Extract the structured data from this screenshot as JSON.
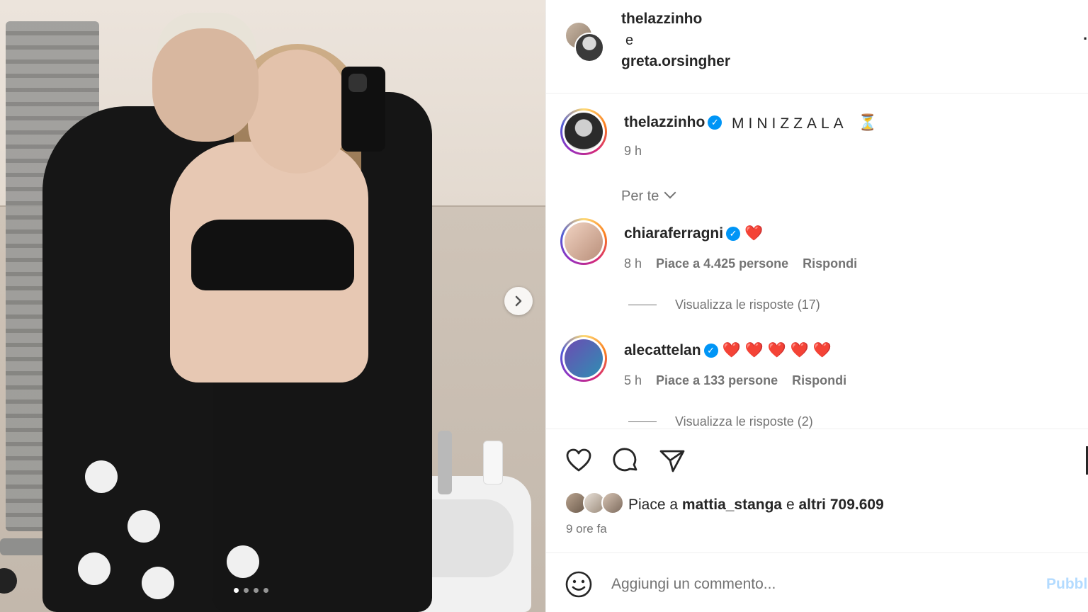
{
  "header": {
    "user1": "thelazzinho",
    "conjunction": "e",
    "user2": "greta.orsingher",
    "more_icon": "more-options-icon"
  },
  "photo": {
    "next_icon": "chevron-right-icon",
    "carousel_pages": 4,
    "carousel_active": 0
  },
  "caption": {
    "username": "thelazzinho",
    "text": "MINIZZALA",
    "emoji": "⏳",
    "time": "9 h"
  },
  "filter": {
    "label": "Per te"
  },
  "comments": [
    {
      "username": "chiaraferragni",
      "verified": true,
      "text": "❤️",
      "time": "8 h",
      "likes": "Piace a 4.425 persone",
      "reply": "Rispondi",
      "replies": "Visualizza le risposte (17)"
    },
    {
      "username": "alecattelan",
      "verified": true,
      "text": "❤️ ❤️ ❤️ ❤️ ❤️",
      "time": "5 h",
      "likes": "Piace a 133 persone",
      "reply": "Rispondi",
      "replies": "Visualizza le risposte (2)"
    }
  ],
  "actions": {
    "like_icon": "heart-icon",
    "comment_icon": "comment-icon",
    "share_icon": "share-icon",
    "save_icon": "bookmark-icon",
    "likes_prefix": "Piace a",
    "likes_user": "mattia_stanga",
    "likes_middle": "e",
    "likes_others": "altri 709.609",
    "post_time": "9 ore fa"
  },
  "comment_box": {
    "placeholder": "Aggiungi un commento...",
    "publish": "Pubblica"
  },
  "colors": {
    "verified": "#0095f6",
    "heart": "#e0182d",
    "publish_disabled": "#b3dbff",
    "secondary_text": "#737373"
  }
}
